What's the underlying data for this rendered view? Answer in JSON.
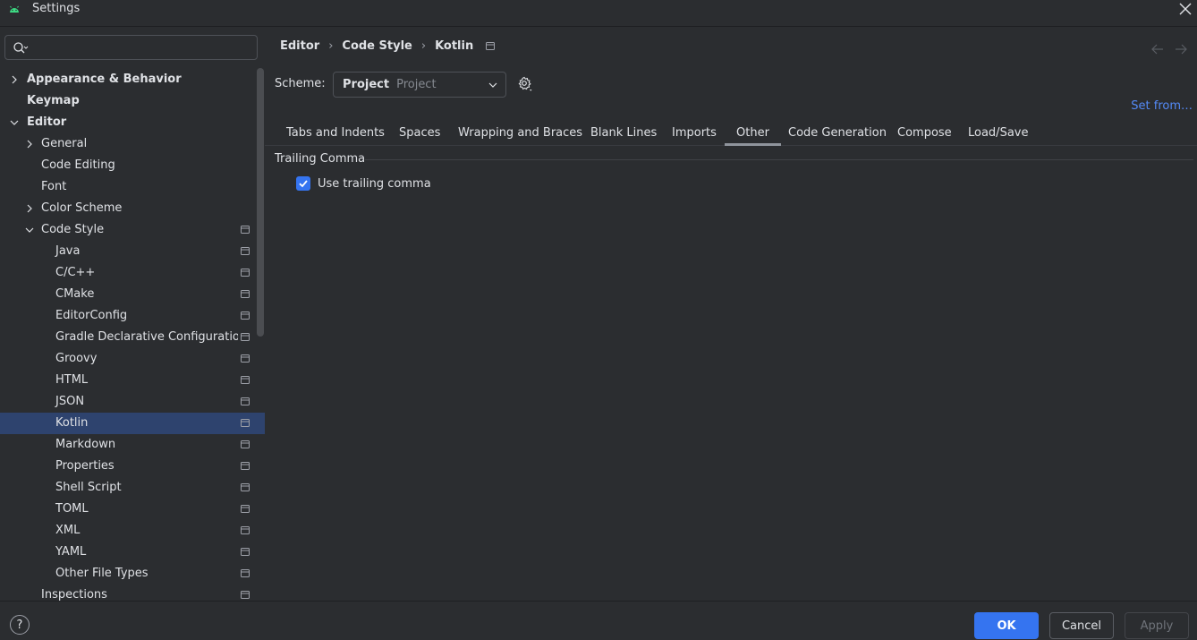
{
  "window": {
    "title": "Settings"
  },
  "search": {
    "placeholder": "",
    "value": ""
  },
  "tree": {
    "appearance": "Appearance & Behavior",
    "keymap": "Keymap",
    "editor": "Editor",
    "general": "General",
    "code_editing": "Code Editing",
    "font": "Font",
    "color_scheme": "Color Scheme",
    "code_style": "Code Style",
    "java": "Java",
    "cpp": "C/C++",
    "cmake": "CMake",
    "editorconfig": "EditorConfig",
    "gradle": "Gradle Declarative Configuration La",
    "groovy": "Groovy",
    "html": "HTML",
    "json": "JSON",
    "kotlin": "Kotlin",
    "markdown": "Markdown",
    "properties": "Properties",
    "shell": "Shell Script",
    "toml": "TOML",
    "xml": "XML",
    "yaml": "YAML",
    "other_types": "Other File Types",
    "inspections": "Inspections"
  },
  "breadcrumb": {
    "part1": "Editor",
    "part2": "Code Style",
    "part3": "Kotlin",
    "sep": "›"
  },
  "scheme": {
    "label": "Scheme:",
    "value": "Project",
    "sub": "Project"
  },
  "set_from": "Set from…",
  "tabs": {
    "t1": "Tabs and Indents",
    "t2": "Spaces",
    "t3": "Wrapping and Braces",
    "t4": "Blank Lines",
    "t5": "Imports",
    "t6": "Other",
    "t7": "Code Generation",
    "t8": "Compose",
    "t9": "Load/Save"
  },
  "section": {
    "title": "Trailing Comma",
    "checkbox_label": "Use trailing comma",
    "checked": true
  },
  "footer": {
    "help": "?",
    "ok": "OK",
    "cancel": "Cancel",
    "apply": "Apply"
  },
  "colors": {
    "accent": "#3574f0",
    "selection": "#2e436e",
    "link": "#548af7",
    "background": "#2b2d30"
  }
}
